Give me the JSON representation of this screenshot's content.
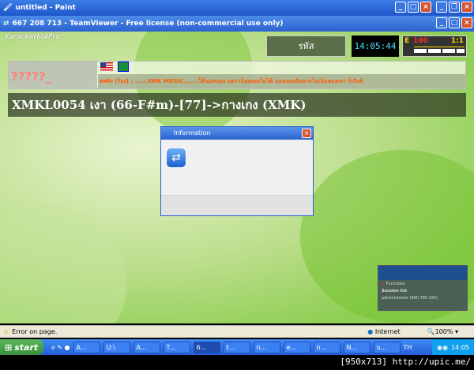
{
  "paint_window": {
    "title": "untitled - Paint"
  },
  "teamviewer_window": {
    "title": "667 208 713 - TeamViewer - Free license (non-commercial use only)"
  },
  "app": {
    "logo_text": "KaraokeHit4Pro",
    "code_label": "รหัส",
    "clock": "14:05:44",
    "e_label": "E",
    "e_value": "100",
    "ratio": "1:1",
    "song_number": "?????_",
    "ticker": "ศศศิง (ร้อง) : ......XMK MUSIC.......โล้นแทนอง แตว่าก็ออลองไม่ได้ มองเธอเดินจากไปเป็นของเขา ก็เกิงคุ้",
    "now_playing": "XMKL0054 เงา (66-F#m)-[77]->กางเกง (XMK)"
  },
  "dialog": {
    "title": "Information"
  },
  "tv_panel": {
    "functions": "Functions",
    "session_list": "Session list",
    "session": "administrator (660 790 320)"
  },
  "statusbar": {
    "text": "Error on page.",
    "zone": "Internet",
    "zoom": "100%"
  },
  "taskbar": {
    "start": "start",
    "items": [
      "A...",
      "U:\\",
      "A...",
      "T...",
      "6...",
      "t...",
      "n...",
      "e...",
      "n...",
      "N...",
      "บ..."
    ],
    "lang": "TH",
    "time": "14:05"
  },
  "watermark": "[950x713] http://upic.me/",
  "colors": {
    "titlebar": "#245edb",
    "ticker_text": "#ff5a00",
    "song_number": "#ff8080",
    "clock": "#40e0ff"
  }
}
